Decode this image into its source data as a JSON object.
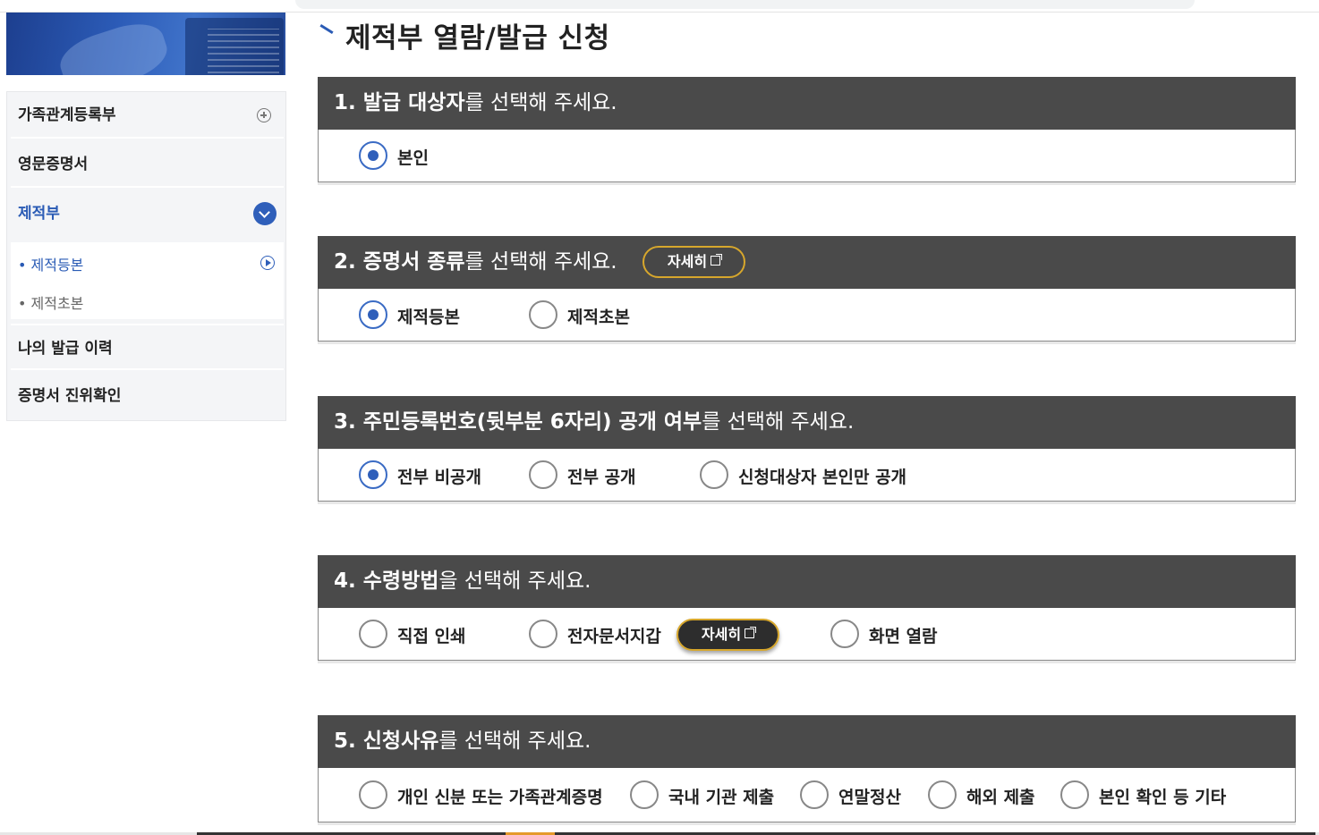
{
  "sidebar": {
    "items": [
      {
        "label": "가족관계등록부"
      },
      {
        "label": "영문증명서"
      },
      {
        "label": "제적부"
      },
      {
        "label": "나의 발급 이력"
      },
      {
        "label": "증명서 진위확인"
      }
    ],
    "sub_items": [
      {
        "label": "• 제적등본"
      },
      {
        "label": "• 제적초본"
      }
    ]
  },
  "page": {
    "title": "제적부 열람/발급 신청"
  },
  "sections": [
    {
      "head_bold": "1. 발급 대상자",
      "head_rest": "를 선택해 주세요.",
      "options": [
        {
          "label": "본인",
          "checked": true
        }
      ]
    },
    {
      "head_bold": "2. 증명서 종류",
      "head_rest": "를 선택해 주세요.",
      "detail_label": "자세히",
      "options": [
        {
          "label": "제적등본",
          "checked": true
        },
        {
          "label": "제적초본",
          "checked": false
        }
      ]
    },
    {
      "head_bold": "3. 주민등록번호(뒷부분 6자리) 공개 여부",
      "head_rest": "를 선택해 주세요.",
      "options": [
        {
          "label": "전부 비공개",
          "checked": true
        },
        {
          "label": "전부 공개",
          "checked": false
        },
        {
          "label": "신청대상자 본인만 공개",
          "checked": false
        }
      ]
    },
    {
      "head_bold": "4. 수령방법",
      "head_rest": "을 선택해 주세요.",
      "detail_label": "자세히",
      "options": [
        {
          "label": "직접 인쇄",
          "checked": false
        },
        {
          "label": "전자문서지갑",
          "checked": false
        },
        {
          "label": "화면 열람",
          "checked": false
        }
      ]
    },
    {
      "head_bold": "5. 신청사유",
      "head_rest": "를 선택해 주세요.",
      "options": [
        {
          "label": "개인 신분 또는 가족관계증명",
          "checked": false
        },
        {
          "label": "국내 기관 제출",
          "checked": false
        },
        {
          "label": "연말정산",
          "checked": false
        },
        {
          "label": "해외 제출",
          "checked": false
        },
        {
          "label": "본인 확인 등 기타",
          "checked": false
        }
      ]
    }
  ],
  "colors": {
    "accent": "#2f5fba",
    "header_bg": "#4a4a4a",
    "button_border": "#d7a72c"
  }
}
